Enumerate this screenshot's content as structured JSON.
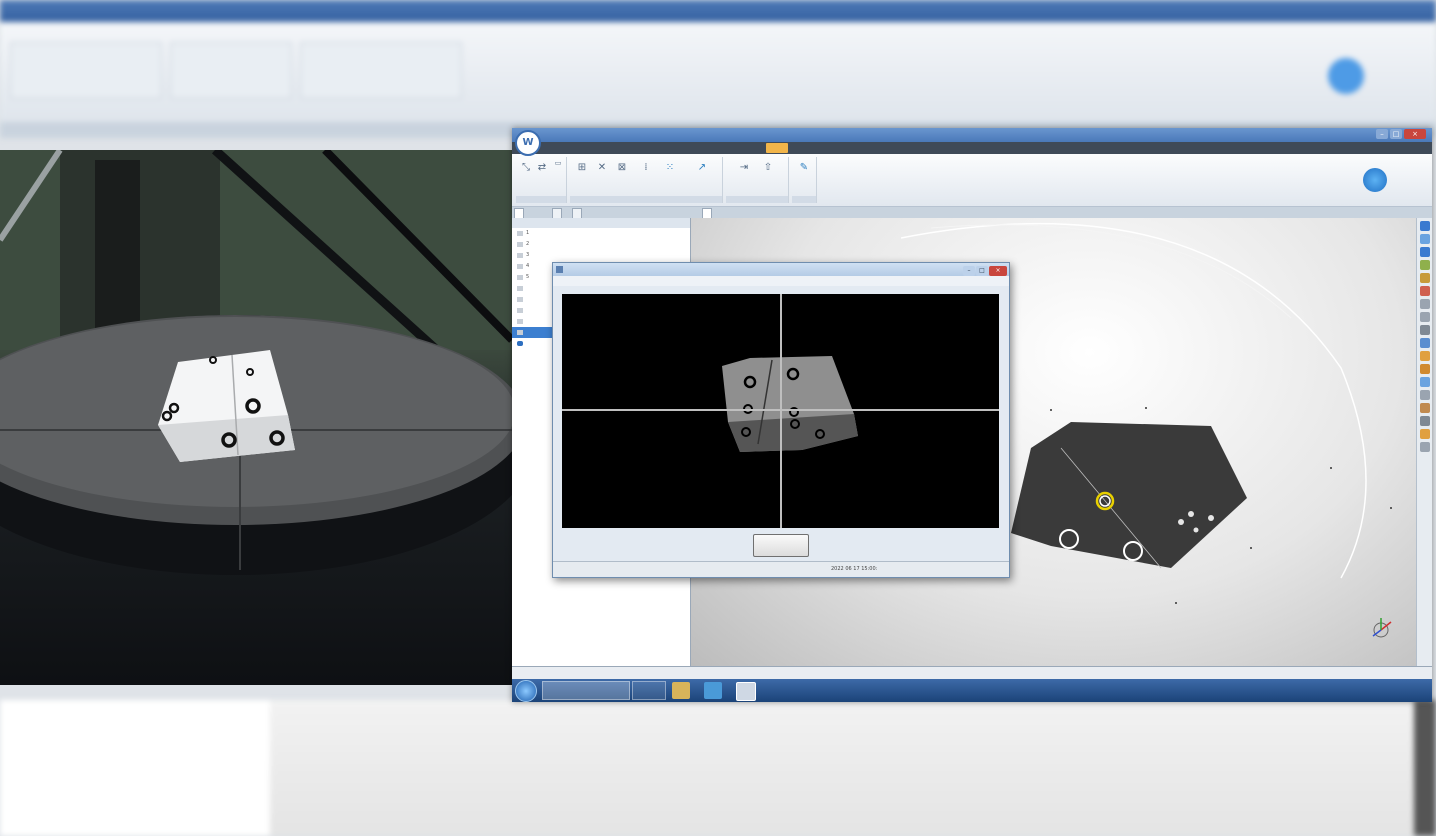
{
  "app": {
    "logo_letter": "W",
    "title": "",
    "menu": [
      "",
      "",
      "",
      "",
      "",
      "",
      "",
      "",
      "",
      "",
      ""
    ],
    "active_menu_index": 10,
    "search_placeholder": "",
    "ribbon_groups": [
      "",
      "",
      "",
      ""
    ],
    "doc_tabs": [
      "",
      "",
      ""
    ],
    "viewport_tab": "",
    "tree_header": "",
    "tree_items": [
      "1",
      "2",
      "3",
      "4",
      "5",
      "",
      "",
      "",
      "",
      "",
      ""
    ],
    "selected_tree_index": 9,
    "statusbar": [
      "",
      "",
      "",
      "",
      "",
      ""
    ],
    "viewport_info": [
      "",
      ""
    ]
  },
  "dialog": {
    "title": "",
    "menu": [
      "",
      "",
      "",
      "",
      ""
    ],
    "button_label": "",
    "status_left": "",
    "status_right": "2022 06 17 15:00:"
  },
  "taskbar": {
    "items": [
      "",
      ""
    ],
    "clock_time": "",
    "clock_date": ""
  },
  "colors": {
    "accent": "#3c7fd0",
    "menu_active": "#f2b54a",
    "marker_highlight": "#e8d000"
  }
}
